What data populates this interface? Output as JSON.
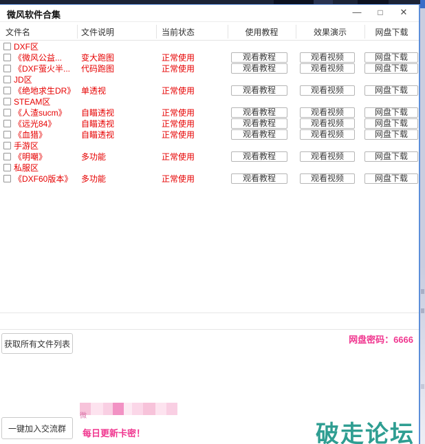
{
  "window": {
    "title": "微风软件合集",
    "controls": {
      "minimize": "—",
      "maximize": "□",
      "close": "✕"
    }
  },
  "table": {
    "columns": [
      "文件名",
      "文件说明",
      "当前状态",
      "使用教程",
      "效果演示",
      "网盘下载"
    ],
    "row_buttons": {
      "tutorial": "观看教程",
      "video": "观看视频",
      "download": "网盘下载"
    },
    "rows": [
      {
        "name": "DXF区",
        "desc": "",
        "status": "",
        "has_buttons": false
      },
      {
        "name": "《微风公益...",
        "desc": "变大跑图",
        "status": "正常使用",
        "has_buttons": true
      },
      {
        "name": "《DXF萤火半...",
        "desc": "代码跑图",
        "status": "正常使用",
        "has_buttons": true
      },
      {
        "name": "JD区",
        "desc": "",
        "status": "",
        "has_buttons": false
      },
      {
        "name": "《绝地求生DR》",
        "desc": "单透视",
        "status": "正常使用",
        "has_buttons": true
      },
      {
        "name": "STEAM区",
        "desc": "",
        "status": "",
        "has_buttons": false
      },
      {
        "name": "《人渣sucm》",
        "desc": "自瞄透视",
        "status": "正常使用",
        "has_buttons": true
      },
      {
        "name": "《远光84》",
        "desc": "自瞄透视",
        "status": "正常使用",
        "has_buttons": true
      },
      {
        "name": "《血猎》",
        "desc": "自瞄透视",
        "status": "正常使用",
        "has_buttons": true
      },
      {
        "name": "手游区",
        "desc": "",
        "status": "",
        "has_buttons": false
      },
      {
        "name": "《明嘲》",
        "desc": "多功能",
        "status": "正常使用",
        "has_buttons": true
      },
      {
        "name": "私服区",
        "desc": "",
        "status": "",
        "has_buttons": false
      },
      {
        "name": "《DXF60版本》",
        "desc": "多功能",
        "status": "正常使用",
        "has_buttons": true
      }
    ]
  },
  "footer": {
    "get_files_button": "获取所有文件列表",
    "password_label": "网盘密码：",
    "password_value": "6666",
    "join_group_button": "一键加入交流群",
    "daily_update_text": "每日更新卡密！",
    "watermark": "破走论坛",
    "censored_hint": "微"
  },
  "colors": {
    "row_text": "#e60000",
    "pink_accent": "#f0368f",
    "watermark_teal": "#2f9e92",
    "window_border": "#5c8ed9"
  }
}
